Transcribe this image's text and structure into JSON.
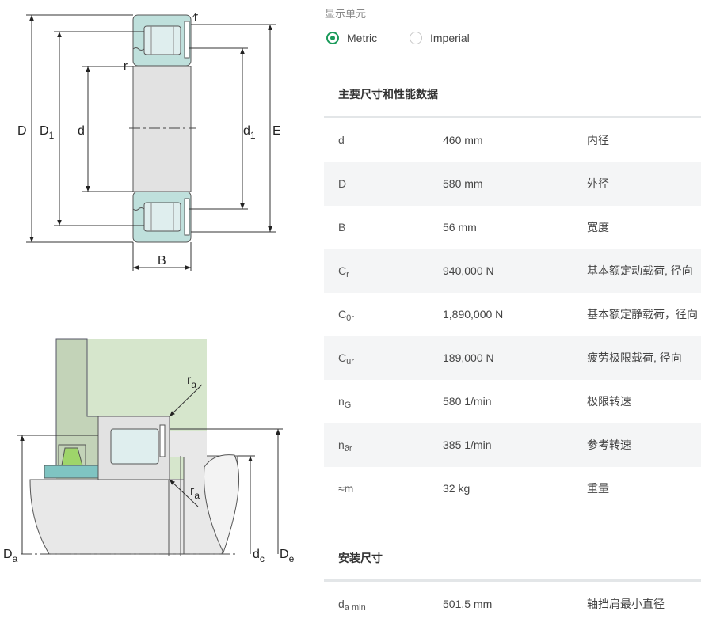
{
  "drawing_top": {
    "labels": {
      "D": "D",
      "D1_main": "D",
      "D1_sub": "1",
      "d": "d",
      "d1_main": "d",
      "d1_sub": "1",
      "E": "E",
      "B": "B",
      "r_top": "r",
      "r_mid": "r"
    }
  },
  "drawing_bottom": {
    "labels": {
      "ra_top_main": "r",
      "ra_top_sub": "a",
      "ra_low_main": "r",
      "ra_low_sub": "a",
      "Da_main": "D",
      "Da_sub": "a",
      "dc_main": "d",
      "dc_sub": "c",
      "De_main": "D",
      "De_sub": "e"
    }
  },
  "units": {
    "title": "显示单元",
    "options": [
      {
        "label": "Metric",
        "selected": true
      },
      {
        "label": "Imperial",
        "selected": false
      }
    ]
  },
  "main_section": {
    "title": "主要尺寸和性能数据",
    "rows": [
      {
        "sym": "d",
        "sub": "",
        "value": "460 mm",
        "desc": "内径"
      },
      {
        "sym": "D",
        "sub": "",
        "value": "580 mm",
        "desc": "外径"
      },
      {
        "sym": "B",
        "sub": "",
        "value": "56 mm",
        "desc": "宽度"
      },
      {
        "sym": "C",
        "sub": "r",
        "value": "940,000 N",
        "desc": "基本额定动载荷, 径向"
      },
      {
        "sym": "C",
        "sub": "0r",
        "value": "1,890,000 N",
        "desc": "基本额定静载荷，径向"
      },
      {
        "sym": "C",
        "sub": "ur",
        "value": "189,000 N",
        "desc": "疲劳极限载荷, 径向"
      },
      {
        "sym": "n",
        "sub": "G",
        "value": "580 1/min",
        "desc": "极限转速"
      },
      {
        "sym": "n",
        "sub": "ϑr",
        "value": "385 1/min",
        "desc": "参考转速"
      },
      {
        "sym": "≈m",
        "sub": "",
        "value": "32 kg",
        "desc": "重量"
      }
    ]
  },
  "mount_section": {
    "title": "安装尺寸",
    "rows": [
      {
        "sym": "d",
        "sub": "a min",
        "value": "501.5 mm",
        "desc": "轴挡肩最小直径"
      }
    ]
  },
  "colors": {
    "accent": "#1a9a5a",
    "ring_teal": "#bfe0dc",
    "body_gray": "#e2e2e2",
    "housing_green": "#d6e6cc"
  }
}
